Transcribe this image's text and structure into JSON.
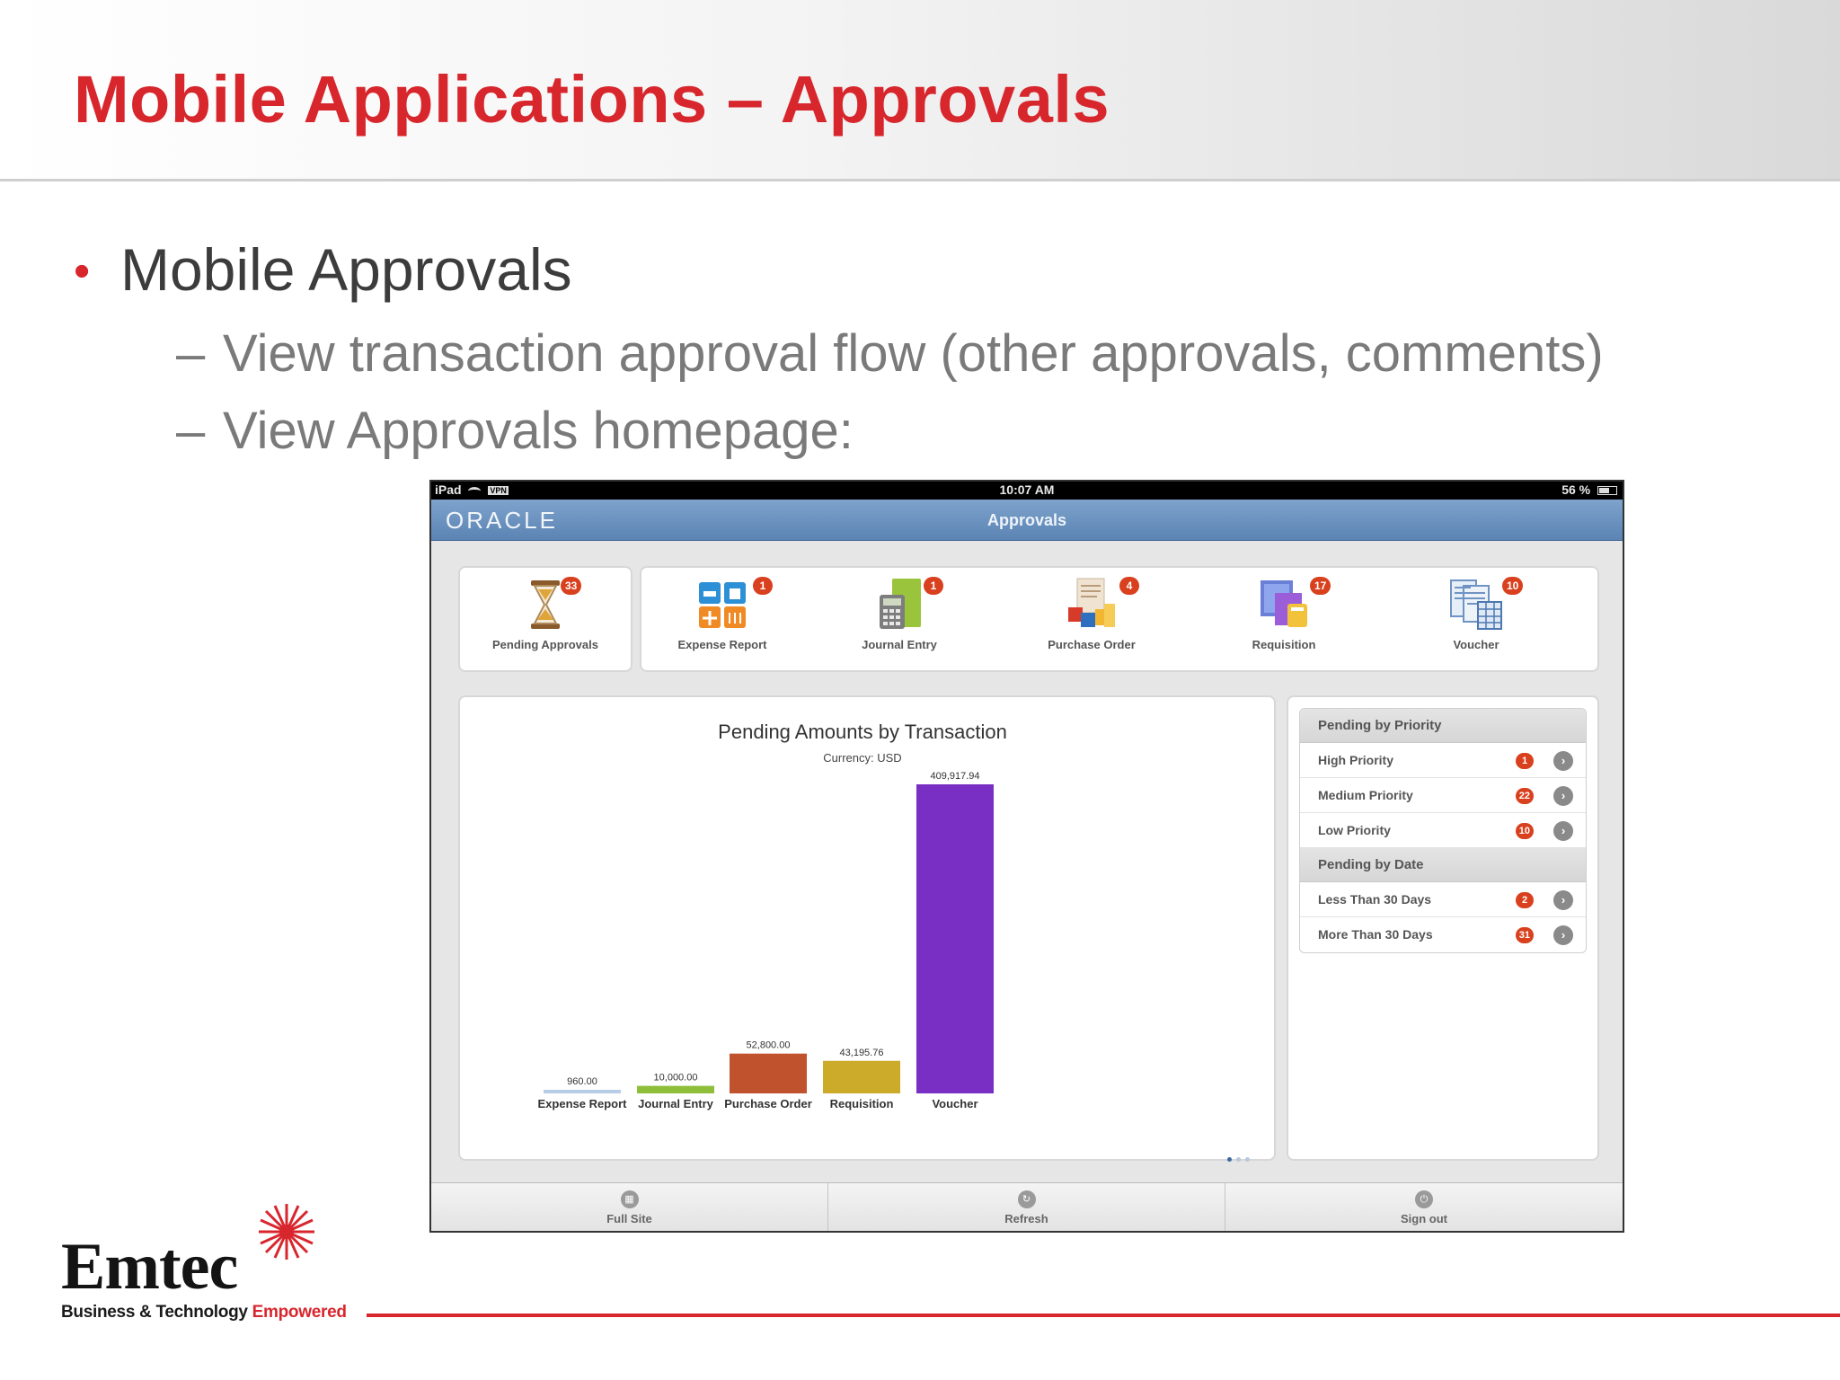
{
  "slide": {
    "title": "Mobile Applications – Approvals",
    "bullet": "•",
    "dash": "–",
    "level1": "Mobile Approvals",
    "level2": [
      "View transaction approval flow (other approvals, comments)",
      "View Approvals homepage:"
    ]
  },
  "logo": {
    "word": "Emtec",
    "tagline_main": "Business & Technology ",
    "tagline_red": "Empowered"
  },
  "colors": {
    "accent": "#d8262d",
    "badge": "#d8401e",
    "header_blue": "#6a92c0"
  },
  "ipad": {
    "status": {
      "device": "iPad",
      "vpn": "VPN",
      "time": "10:07 AM",
      "battery": "56 %"
    },
    "brand": "ORACLE",
    "app_title": "Approvals",
    "tiles": [
      {
        "label": "Pending Approvals",
        "badge": "33",
        "icon": "hourglass-icon"
      },
      {
        "label": "Expense Report",
        "badge": "1",
        "icon": "expense-report-icon"
      },
      {
        "label": "Journal Entry",
        "badge": "1",
        "icon": "journal-entry-icon"
      },
      {
        "label": "Purchase Order",
        "badge": "4",
        "icon": "purchase-order-icon"
      },
      {
        "label": "Requisition",
        "badge": "17",
        "icon": "requisition-icon"
      },
      {
        "label": "Voucher",
        "badge": "10",
        "icon": "voucher-icon"
      }
    ],
    "side": {
      "priority_header": "Pending by Priority",
      "priority": [
        {
          "label": "High Priority",
          "count": "1"
        },
        {
          "label": "Medium Priority",
          "count": "22"
        },
        {
          "label": "Low Priority",
          "count": "10"
        }
      ],
      "date_header": "Pending by Date",
      "date": [
        {
          "label": "Less Than 30 Days",
          "count": "2"
        },
        {
          "label": "More Than 30 Days",
          "count": "31"
        }
      ]
    },
    "bottom": [
      {
        "label": "Full Site",
        "icon": "grid-icon"
      },
      {
        "label": "Refresh",
        "icon": "refresh-icon"
      },
      {
        "label": "Sign out",
        "icon": "power-icon"
      }
    ]
  },
  "chart_data": {
    "type": "bar",
    "title": "Pending Amounts by Transaction",
    "subtitle": "Currency: USD",
    "categories": [
      "Expense Report",
      "Journal Entry",
      "Purchase Order",
      "Requisition",
      "Voucher"
    ],
    "values": [
      960.0,
      10000.0,
      52800.0,
      43195.76,
      409917.94
    ],
    "value_labels": [
      "960.00",
      "10,000.00",
      "52,800.00",
      "43,195.76",
      "409,917.94"
    ],
    "colors": [
      "#b7cde6",
      "#8fbe3a",
      "#c0532e",
      "#ccaa2a",
      "#7a2fc4"
    ],
    "ylim": [
      0,
      409917.94
    ],
    "grid": false,
    "legend": "none"
  }
}
